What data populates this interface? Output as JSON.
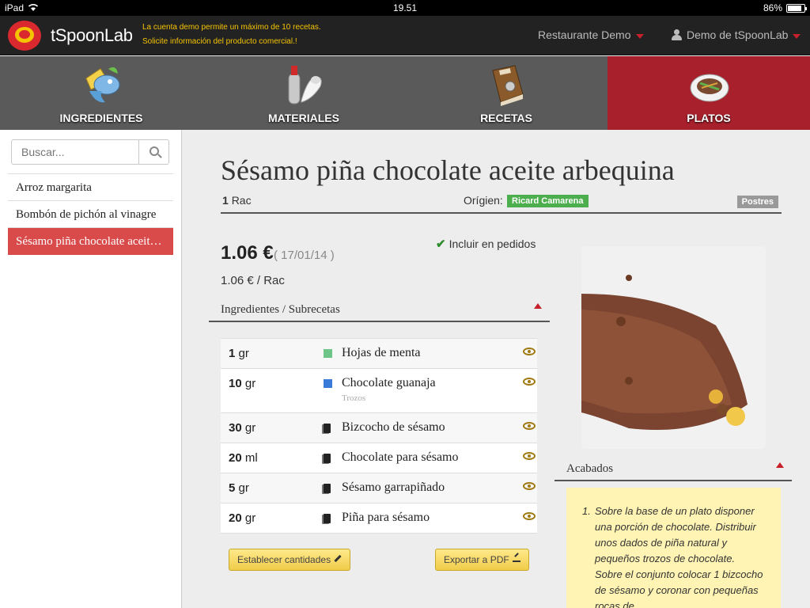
{
  "status": {
    "device": "iPad",
    "time": "19.51",
    "battery": "86%",
    "battery_level": 0.86
  },
  "header": {
    "app_name": "tSpoonLab",
    "demo_line1": "La cuenta demo permite un máximo de 10 recetas.",
    "demo_line2": "Solicite información del producto comercial.!",
    "restaurant": "Restaurante Demo",
    "user": "Demo de tSpoonLab"
  },
  "nav": [
    {
      "label": "INGREDIENTES"
    },
    {
      "label": "MATERIALES"
    },
    {
      "label": "RECETAS"
    },
    {
      "label": "PLATOS"
    }
  ],
  "sidebar": {
    "search_placeholder": "Buscar...",
    "items": [
      {
        "label": "Arroz margarita"
      },
      {
        "label": "Bombón de pichón al vinagre"
      },
      {
        "label": "Sésamo piña chocolate aceite arbequina"
      }
    ]
  },
  "dish": {
    "title": "Sésamo piña chocolate aceite arbequina",
    "portion_qty": "1",
    "portion_unit": "Rac",
    "origin_label": "Orígien:",
    "origin": "Ricard Camarena",
    "category": "Postres",
    "price": "1.06 €",
    "price_date": "( 17/01/14 )",
    "price_per_unit": "1.06 € / Rac",
    "include_label": "Incluir en pedidos"
  },
  "ingredients": {
    "header": "Ingredientes / Subrecetas",
    "rows": [
      {
        "qty": "1",
        "unit": "gr",
        "name": "Hojas de menta",
        "note": ""
      },
      {
        "qty": "10",
        "unit": "gr",
        "name": "Chocolate guanaja",
        "note": "Trozos"
      },
      {
        "qty": "30",
        "unit": "gr",
        "name": "Bizcocho de sésamo",
        "note": ""
      },
      {
        "qty": "20",
        "unit": "ml",
        "name": "Chocolate para sésamo",
        "note": ""
      },
      {
        "qty": "5",
        "unit": "gr",
        "name": "Sésamo garrapiñado",
        "note": ""
      },
      {
        "qty": "20",
        "unit": "gr",
        "name": "Piña para sésamo",
        "note": ""
      }
    ],
    "set_quantities": "Establecer cantidades",
    "export_pdf": "Exportar a PDF"
  },
  "finishing": {
    "header": "Acabados",
    "step_number": "1.",
    "step_text": "Sobre la base de un plato disponer una porción de chocolate. Distribuir unos dados de piña natural y pequeños trozos de chocolate. Sobre el conjunto colocar 1 bizcocho de sésamo y coronar con pequeñas rocas de"
  },
  "colors": {
    "accent_red": "#a8202c",
    "selected_row": "#d94a4a",
    "origin_green": "#4cae4c",
    "note_yellow": "#fff4b4"
  }
}
